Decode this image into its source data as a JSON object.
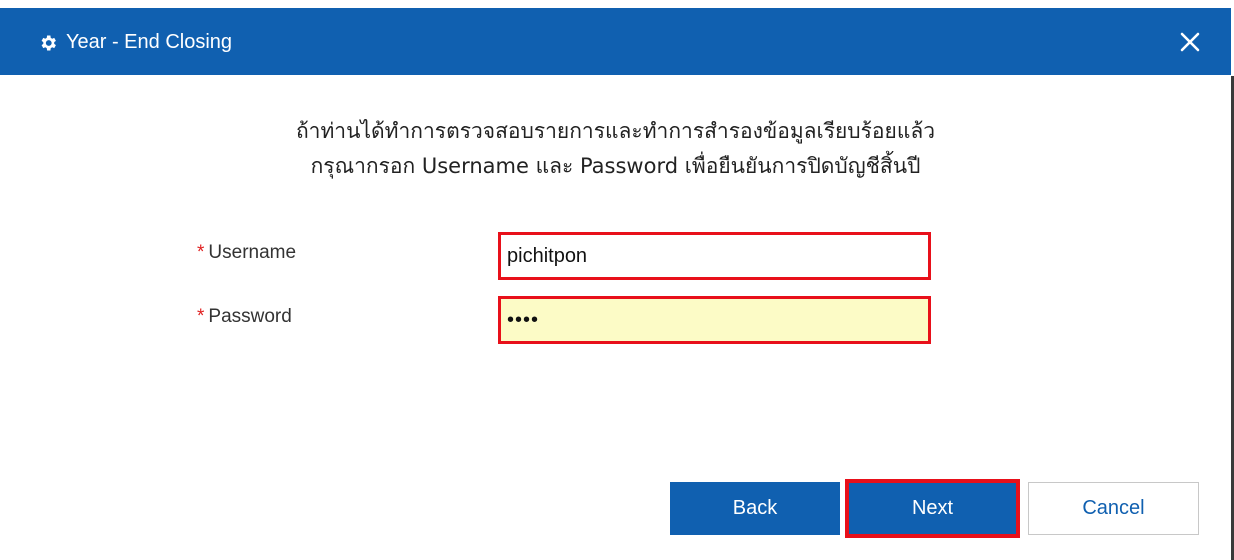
{
  "dialog": {
    "title": "Year - End Closing",
    "title_icon": "gear-icon",
    "close_icon": "close-icon",
    "instruction_line1": "ถ้าท่านได้ทำการตรวจสอบรายการและทำการสำรองข้อมูลเรียบร้อยแล้ว",
    "instruction_line2": "กรุณากรอก Username และ Password เพื่อยืนยันการปิดบัญชีสิ้นปี"
  },
  "form": {
    "required_marker": "*",
    "username_label": "Username",
    "username_value": "pichitpon",
    "password_label": "Password",
    "password_value": "••••"
  },
  "buttons": {
    "back_label": "Back",
    "next_label": "Next",
    "cancel_label": "Cancel"
  },
  "colors": {
    "titlebar": "#1060b0",
    "highlight": "#e8101a",
    "password_bg": "#fcfbc6"
  }
}
